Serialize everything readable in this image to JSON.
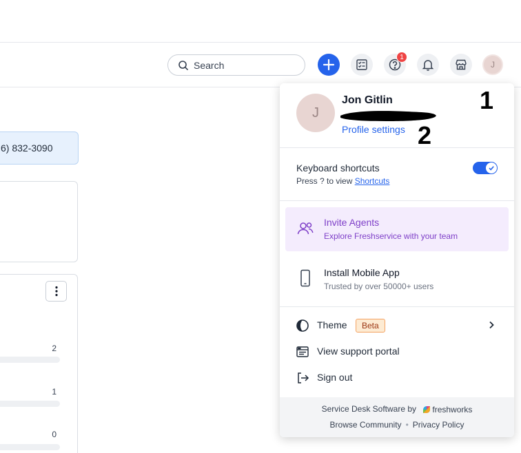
{
  "header": {
    "search_placeholder": "Search",
    "notification_count": "1",
    "avatar_initial": "J"
  },
  "background": {
    "phone": "6) 832-3090",
    "counts": [
      "2",
      "1",
      "0"
    ]
  },
  "dropdown": {
    "avatar_initial": "J",
    "user_name": "Jon Gitlin",
    "profile_settings": "Profile settings",
    "annotations": [
      "1",
      "2"
    ],
    "keyboard": {
      "title": "Keyboard shortcuts",
      "prefix": "Press ? to view ",
      "link": "Shortcuts",
      "enabled": true
    },
    "invite": {
      "title": "Invite Agents",
      "subtitle": "Explore Freshservice with your team"
    },
    "mobile": {
      "title": "Install Mobile App",
      "subtitle": "Trusted by over 50000+ users"
    },
    "menu": {
      "theme": "Theme",
      "theme_badge": "Beta",
      "support_portal": "View support portal",
      "sign_out": "Sign out"
    },
    "footer": {
      "service_desk": "Service Desk Software by",
      "brand": "freshworks",
      "browse_community": "Browse Community",
      "privacy_policy": "Privacy Policy"
    }
  },
  "colors": {
    "accent": "#2563eb",
    "invite_bg": "#f4ecfd",
    "invite_text": "#7e3fc8",
    "badge_red": "#ef4444",
    "beta_bg": "#fdebd3"
  }
}
